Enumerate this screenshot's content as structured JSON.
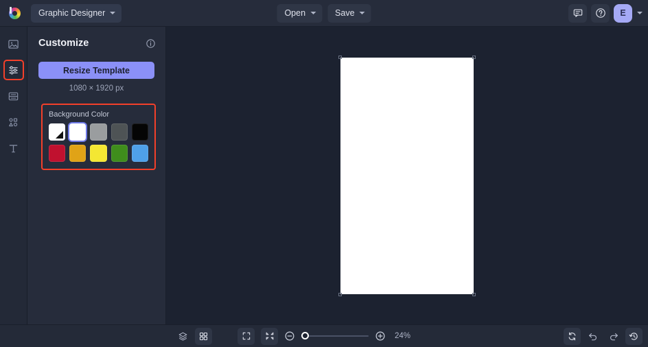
{
  "app": {
    "logo_name": "app-logo",
    "project_name": "Graphic Designer"
  },
  "topbar": {
    "open_label": "Open",
    "save_label": "Save",
    "comments_icon": "comment-icon",
    "help_icon": "help-icon",
    "avatar_initial": "E"
  },
  "rail": {
    "items": [
      {
        "name": "images",
        "icon": "image-icon",
        "active": false
      },
      {
        "name": "customize",
        "icon": "sliders-icon",
        "active": true
      },
      {
        "name": "layouts",
        "icon": "layout-icon",
        "active": false
      },
      {
        "name": "shapes",
        "icon": "shapes-icon",
        "active": false
      },
      {
        "name": "text",
        "icon": "text-icon",
        "active": false
      }
    ]
  },
  "panel": {
    "title": "Customize",
    "info_icon": "info-icon",
    "resize_label": "Resize Template",
    "dimensions": "1080 × 1920 px",
    "background": {
      "label": "Background Color",
      "swatches_row1": [
        {
          "name": "transparent-white",
          "color": "#ffffff",
          "selected": false,
          "diagonal": true
        },
        {
          "name": "white",
          "color": "#ffffff",
          "selected": true,
          "diagonal": false
        },
        {
          "name": "light-gray",
          "color": "#9a9d9f",
          "selected": false,
          "diagonal": false
        },
        {
          "name": "dark-gray",
          "color": "#4e5355",
          "selected": false,
          "diagonal": false
        },
        {
          "name": "black",
          "color": "#050505",
          "selected": false,
          "diagonal": false
        }
      ],
      "swatches_row2": [
        {
          "name": "crimson",
          "color": "#c0112f",
          "selected": false,
          "diagonal": false
        },
        {
          "name": "amber",
          "color": "#e0a317",
          "selected": false,
          "diagonal": false
        },
        {
          "name": "yellow",
          "color": "#f4e733",
          "selected": false,
          "diagonal": false
        },
        {
          "name": "green",
          "color": "#3f8d1c",
          "selected": false,
          "diagonal": false
        },
        {
          "name": "blue",
          "color": "#4fa0e8",
          "selected": false,
          "diagonal": false
        }
      ]
    }
  },
  "canvas": {
    "page_color": "#ffffff"
  },
  "bottombar": {
    "layers_icon": "layers-icon",
    "grid_icon": "grid-icon",
    "fit_icon": "fit-to-screen-icon",
    "collapse_icon": "collapse-screen-icon",
    "zoom_out_icon": "zoom-out-icon",
    "zoom_in_icon": "zoom-in-icon",
    "zoom_level": "24%",
    "zoom_slider_percent": 0,
    "sync_icon": "sync-icon",
    "undo_icon": "undo-icon",
    "redo_icon": "redo-icon",
    "history_icon": "history-icon"
  },
  "colors": {
    "accent": "#8b90f7",
    "highlight_outline": "#f4402a",
    "panel_bg": "#262c3b",
    "canvas_bg": "#1c2230"
  }
}
